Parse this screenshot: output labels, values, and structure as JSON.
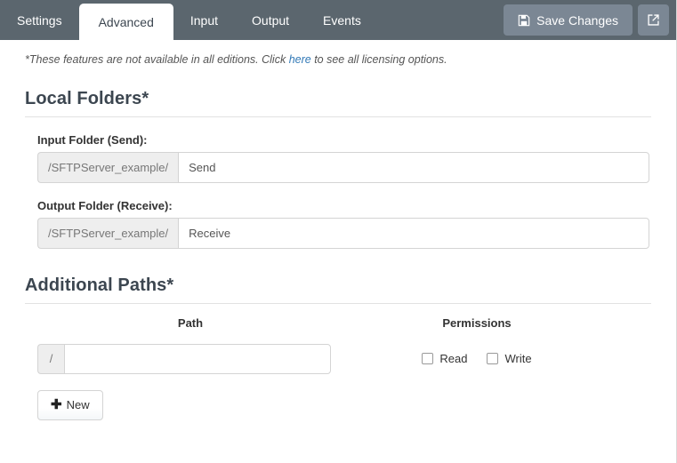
{
  "header": {
    "tabs": [
      {
        "label": "Settings",
        "active": false
      },
      {
        "label": "Advanced",
        "active": true
      },
      {
        "label": "Input",
        "active": false
      },
      {
        "label": "Output",
        "active": false
      },
      {
        "label": "Events",
        "active": false
      }
    ],
    "save_label": "Save Changes",
    "save_icon": "floppy-disk-icon",
    "external_icon": "external-link-icon",
    "bar_color": "#5b666e",
    "button_color": "#7b8794"
  },
  "notice": {
    "before_link": "*These features are not available in all editions. Click ",
    "link_text": "here",
    "after_link": " to see all licensing options.",
    "link_color": "#337ab7"
  },
  "local_folders": {
    "title": "Local Folders*",
    "input_folder": {
      "label": "Input Folder (Send):",
      "prefix": "/SFTPServer_example/",
      "value": "Send",
      "placeholder": ""
    },
    "output_folder": {
      "label": "Output Folder (Receive):",
      "prefix": "/SFTPServer_example/",
      "value": "Receive",
      "placeholder": ""
    }
  },
  "additional_paths": {
    "title": "Additional Paths*",
    "columns": {
      "path": "Path",
      "permissions": "Permissions"
    },
    "rows": [
      {
        "prefix": "/",
        "value": "",
        "placeholder": "",
        "read_label": "Read",
        "read_checked": false,
        "write_label": "Write",
        "write_checked": false
      }
    ],
    "new_button": {
      "label": "New",
      "icon": "plus-icon"
    }
  }
}
